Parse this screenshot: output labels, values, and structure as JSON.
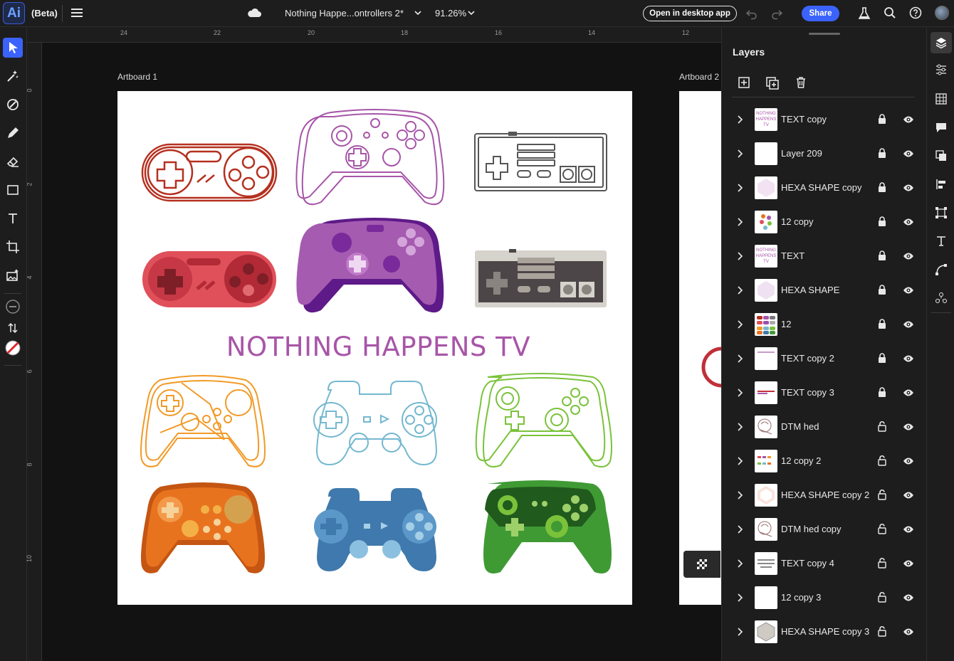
{
  "app": {
    "logo": "Ai",
    "badge": "(Beta)"
  },
  "header": {
    "doc_title": "Nothing Happe...ontrollers 2*",
    "zoom": "91.26%",
    "open_desktop": "Open in desktop app",
    "share": "Share"
  },
  "rulers": {
    "horizontal": [
      "24",
      "22",
      "20",
      "18",
      "16",
      "14",
      "12"
    ],
    "vertical": [
      "0",
      "2",
      "4",
      "6",
      "8",
      "10"
    ]
  },
  "canvas": {
    "artboard1_label": "Artboard 1",
    "artboard2_label": "Artboard 2",
    "artboard_title": "NOTHING HAPPENS TV",
    "controller_colors": {
      "snes_outline": "#b5301f",
      "xbox_outline": "#a755a8",
      "nes_outline": "#555555",
      "snes_fill": "#e0505a",
      "xbox_fill": "#9b4fb0",
      "nes_fill": "#d6d2cc",
      "orange": "#f29a27",
      "blue": "#74b8d0",
      "green": "#7ac23a",
      "orange_fill": "#e8731f",
      "blue_fill": "#3f79ad",
      "green_fill": "#3f9a34"
    }
  },
  "layers_panel": {
    "title": "Layers",
    "layers": [
      {
        "name": "TEXT copy",
        "locked": true
      },
      {
        "name": "Layer 209",
        "locked": true
      },
      {
        "name": "HEXA SHAPE copy",
        "locked": true
      },
      {
        "name": "12 copy",
        "locked": true
      },
      {
        "name": "TEXT",
        "locked": true
      },
      {
        "name": "HEXA SHAPE",
        "locked": true
      },
      {
        "name": "12",
        "locked": true
      },
      {
        "name": "TEXT copy 2",
        "locked": true
      },
      {
        "name": "TEXT copy 3",
        "locked": true
      },
      {
        "name": "DTM hed",
        "locked": false
      },
      {
        "name": "12 copy 2",
        "locked": false
      },
      {
        "name": "HEXA SHAPE copy 2",
        "locked": false
      },
      {
        "name": "DTM hed copy",
        "locked": false
      },
      {
        "name": "TEXT copy 4",
        "locked": false
      },
      {
        "name": "12 copy 3",
        "locked": false
      },
      {
        "name": "HEXA SHAPE copy 3",
        "locked": false
      }
    ]
  }
}
